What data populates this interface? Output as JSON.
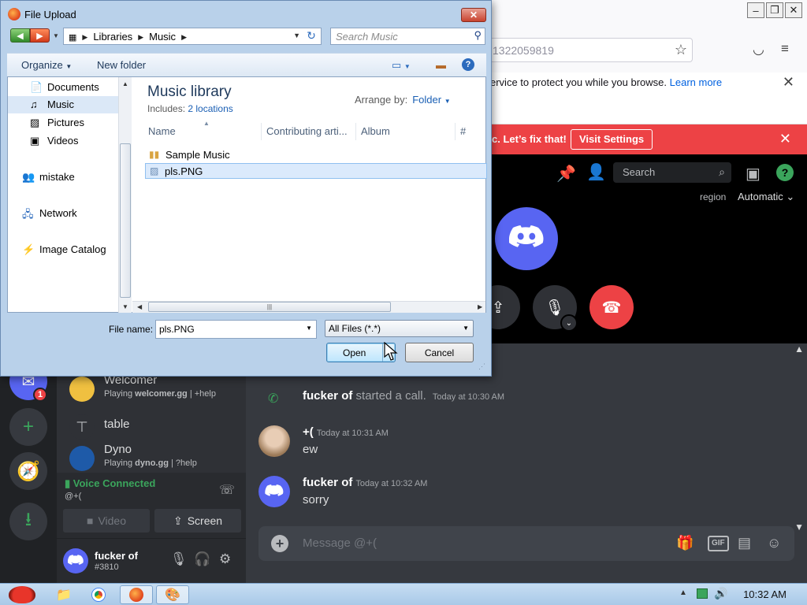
{
  "firefox": {
    "url_fragment": "1322059819",
    "notice_text": "ervice to protect you while you browse.",
    "notice_link": "Learn more"
  },
  "discord": {
    "banner": {
      "text": "c. Let’s fix that!",
      "button": "Visit Settings"
    },
    "call": {
      "search_placeholder": "Search",
      "region_label": "region",
      "region_value": "Automatic"
    },
    "guilds": {
      "mention_badge": "1"
    },
    "dms": [
      {
        "name": "Welcomer",
        "status_prefix": "Playing ",
        "status_game": "welcomer.gg",
        "status_suffix": " | +help"
      },
      {
        "name": "table",
        "status_prefix": "",
        "status_game": "",
        "status_suffix": ""
      },
      {
        "name": "Dyno",
        "status_prefix": "Playing ",
        "status_game": "dyno.gg",
        "status_suffix": " | ?help"
      }
    ],
    "voice": {
      "status": "Voice Connected",
      "channel": "@+(",
      "video_label": "Video",
      "screen_label": "Screen"
    },
    "user": {
      "name": "fucker of",
      "tag": "#3810"
    },
    "messages": [
      {
        "author": "fucker of",
        "text": "started a call.",
        "time": "Today at 10:30 AM",
        "type": "system"
      },
      {
        "author": "+(",
        "time": "Today at 10:31 AM",
        "text": "ew",
        "type": "message"
      },
      {
        "author": "fucker of",
        "time": "Today at 10:32 AM",
        "text": "sorry",
        "type": "message"
      }
    ],
    "input_placeholder": "Message @+(",
    "colors": {
      "blurple": "#5865f2",
      "red": "#ed4245",
      "green": "#3ba55c"
    }
  },
  "dialog": {
    "title": "File Upload",
    "address": {
      "part1": "Libraries",
      "part2": "Music"
    },
    "search_placeholder": "Search Music",
    "toolbar": {
      "organize": "Organize",
      "new_folder": "New folder"
    },
    "tree": [
      "Documents",
      "Music",
      "Pictures",
      "Videos",
      "mistake",
      "Network",
      "Image Catalog"
    ],
    "library": {
      "title": "Music library",
      "includes_label": "Includes:",
      "includes_link": "2 locations",
      "arrange_label": "Arrange by:",
      "arrange_value": "Folder"
    },
    "columns": [
      "Name",
      "Contributing arti...",
      "Album",
      "#"
    ],
    "files": [
      "Sample Music",
      "pls.PNG"
    ],
    "filename_label": "File name:",
    "filename_value": "pls.PNG",
    "filetype": "All Files (*.*)",
    "open_label": "Open",
    "cancel_label": "Cancel"
  },
  "taskbar": {
    "clock": "10:32 AM"
  }
}
